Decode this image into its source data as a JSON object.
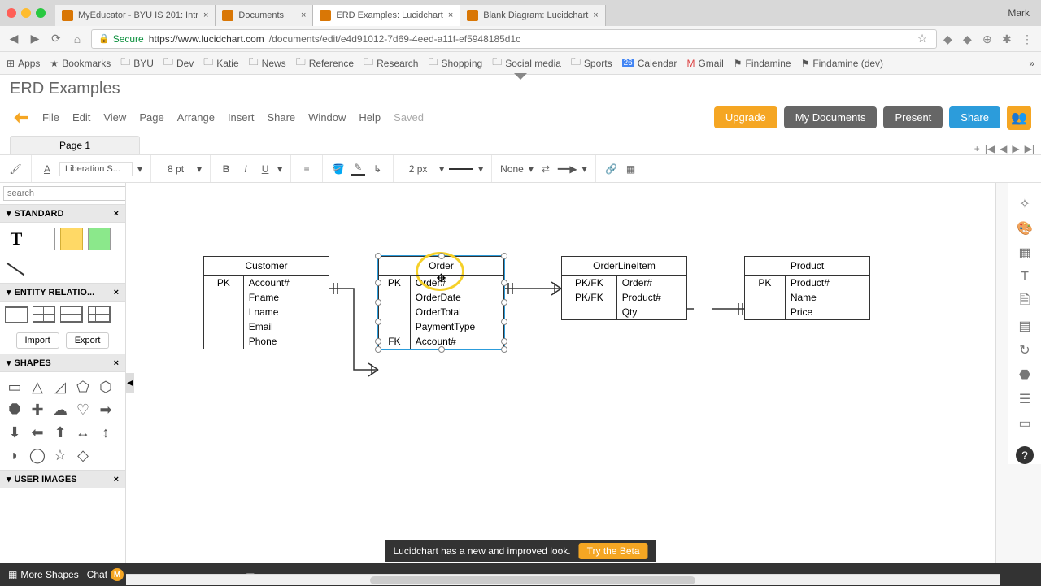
{
  "user_name": "Mark",
  "browser_tabs": [
    {
      "title": "MyEducator - BYU IS 201: Intr",
      "active": false
    },
    {
      "title": "Documents",
      "active": false
    },
    {
      "title": "ERD Examples: Lucidchart",
      "active": true
    },
    {
      "title": "Blank Diagram: Lucidchart",
      "active": false
    }
  ],
  "address_bar": {
    "secure_label": "Secure",
    "url_host": "https://www.lucidchart.com",
    "url_path": "/documents/edit/e4d91012-7d69-4eed-a11f-ef5948185d1c"
  },
  "bookmarks": [
    "Apps",
    "Bookmarks",
    "BYU",
    "Dev",
    "Katie",
    "News",
    "Reference",
    "Research",
    "Shopping",
    "Social media",
    "Sports",
    "Calendar",
    "Gmail",
    "Findamine",
    "Findamine (dev)"
  ],
  "calendar_badge": "26",
  "doc_title": "ERD Examples",
  "menus": [
    "File",
    "Edit",
    "View",
    "Page",
    "Arrange",
    "Insert",
    "Share",
    "Window",
    "Help"
  ],
  "saved_label": "Saved",
  "buttons": {
    "upgrade": "Upgrade",
    "mydocs": "My Documents",
    "present": "Present",
    "share": "Share"
  },
  "page_tab": "Page 1",
  "toolbar": {
    "font": "Liberation S...",
    "font_size": "8 pt",
    "line_width": "2 px",
    "arrow_end": "None"
  },
  "left_panel": {
    "search_placeholder": "search",
    "standard": "STANDARD",
    "entity_rel": "ENTITY RELATIO...",
    "import": "Import",
    "export": "Export",
    "shapes": "SHAPES",
    "user_images": "USER IMAGES"
  },
  "entities": {
    "customer": {
      "title": "Customer",
      "rows": [
        [
          "PK",
          "Account#"
        ],
        [
          "",
          "Fname"
        ],
        [
          "",
          "Lname"
        ],
        [
          "",
          "Email"
        ],
        [
          "",
          "Phone"
        ]
      ]
    },
    "order": {
      "title": "Order",
      "rows": [
        [
          "PK",
          "Order#"
        ],
        [
          "",
          "OrderDate"
        ],
        [
          "",
          "OrderTotal"
        ],
        [
          "",
          "PaymentType"
        ],
        [
          "FK",
          "Account#"
        ]
      ]
    },
    "orderline": {
      "title": "OrderLineItem",
      "rows": [
        [
          "PK/FK",
          "Order#"
        ],
        [
          "PK/FK",
          "Product#"
        ],
        [
          "",
          "Qty"
        ]
      ]
    },
    "product": {
      "title": "Product",
      "rows": [
        [
          "PK",
          "Product#"
        ],
        [
          "",
          "Name"
        ],
        [
          "",
          "Price"
        ]
      ]
    }
  },
  "bottom": {
    "more_shapes": "More Shapes",
    "chat": "Chat",
    "chat_badge": "M"
  },
  "beta": {
    "msg": "Lucidchart has a new and improved look.",
    "btn": "Try the Beta"
  }
}
